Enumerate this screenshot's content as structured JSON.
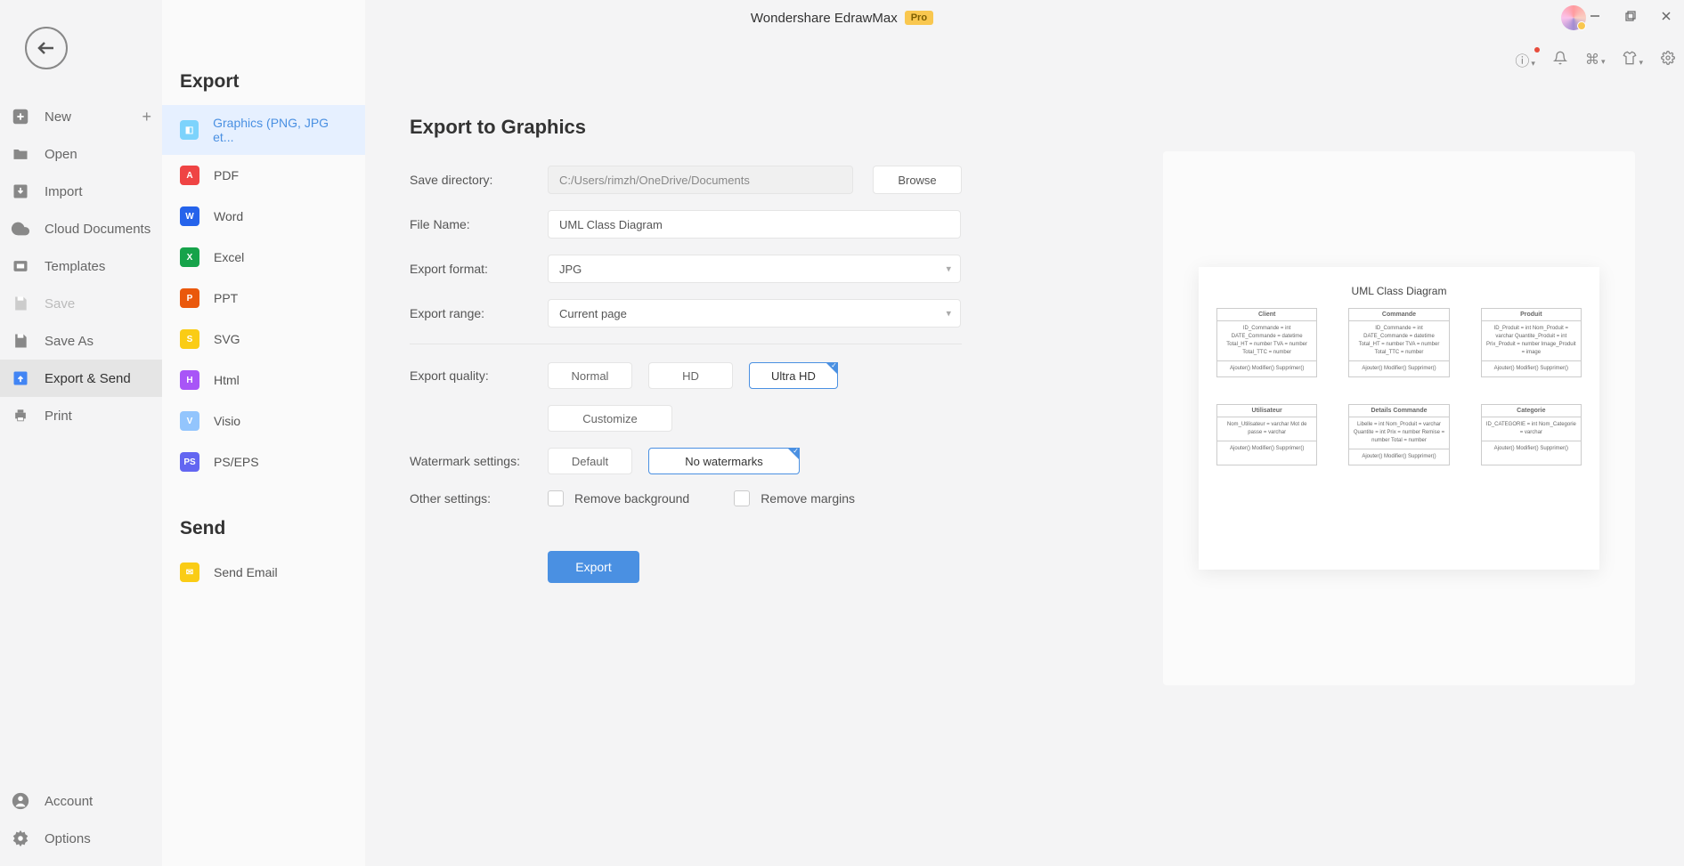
{
  "app": {
    "title": "Wondershare EdrawMax",
    "badge": "Pro"
  },
  "leftNav": {
    "new": "New",
    "open": "Open",
    "import": "Import",
    "cloud": "Cloud Documents",
    "templates": "Templates",
    "save": "Save",
    "saveAs": "Save As",
    "exportSend": "Export & Send",
    "print": "Print",
    "account": "Account",
    "options": "Options"
  },
  "exportPanel": {
    "title": "Export",
    "sendTitle": "Send",
    "graphics": "Graphics (PNG, JPG et...",
    "pdf": "PDF",
    "word": "Word",
    "excel": "Excel",
    "ppt": "PPT",
    "svg": "SVG",
    "html": "Html",
    "visio": "Visio",
    "pseps": "PS/EPS",
    "sendEmail": "Send Email"
  },
  "main": {
    "title": "Export to Graphics",
    "saveDirLabel": "Save directory:",
    "saveDirValue": "C:/Users/rimzh/OneDrive/Documents",
    "browse": "Browse",
    "fileNameLabel": "File Name:",
    "fileNameValue": "UML Class Diagram",
    "formatLabel": "Export format:",
    "formatValue": "JPG",
    "rangeLabel": "Export range:",
    "rangeValue": "Current page",
    "qualityLabel": "Export quality:",
    "qNormal": "Normal",
    "qHD": "HD",
    "qUltra": "Ultra HD",
    "qCustomize": "Customize",
    "watermarkLabel": "Watermark settings:",
    "wDefault": "Default",
    "wNone": "No watermarks",
    "otherLabel": "Other settings:",
    "removeBg": "Remove background",
    "removeMargins": "Remove margins",
    "exportBtn": "Export"
  },
  "preview": {
    "title": "UML Class Diagram",
    "boxes": {
      "client": {
        "name": "Client",
        "attrs": "ID_Commande = int\nDATE_Commande = datetime\nTotal_HT = number\nTVA = number\nTotal_TTC = number",
        "ops": "Ajouter()\nModifier()\nSupprimer()"
      },
      "commande": {
        "name": "Commande",
        "attrs": "ID_Commande = int\nDATE_Commande = datetime\nTotal_HT = number\nTVA = number\nTotal_TTC = number",
        "ops": "Ajouter()\nModifier()\nSupprimer()"
      },
      "produit": {
        "name": "Produit",
        "attrs": "ID_Produit = int\nNom_Produit = varchar\nQuantite_Produit = int\nPrix_Produit = number\nImage_Produit = image",
        "ops": "Ajouter()\nModifier()\nSupprimer()"
      },
      "utilisateur": {
        "name": "Utilisateur",
        "attrs": "Nom_Utilisateur = varchar\nMot de passe = varchar",
        "ops": "Ajouter()\nModifier()\nSupprimer()"
      },
      "details": {
        "name": "Details Commande",
        "attrs": "Libelle = int\nNom_Produit = varchar\nQuantite = int\nPrix = number\nRemise = number\nTotal = number",
        "ops": "Ajouter()\nModifier()\nSupprimer()"
      },
      "categorie": {
        "name": "Categorie",
        "attrs": "ID_CATEGORIE = int\nNom_Categorie = varchar",
        "ops": "Ajouter()\nModifier()\nSupprimer()"
      }
    }
  }
}
